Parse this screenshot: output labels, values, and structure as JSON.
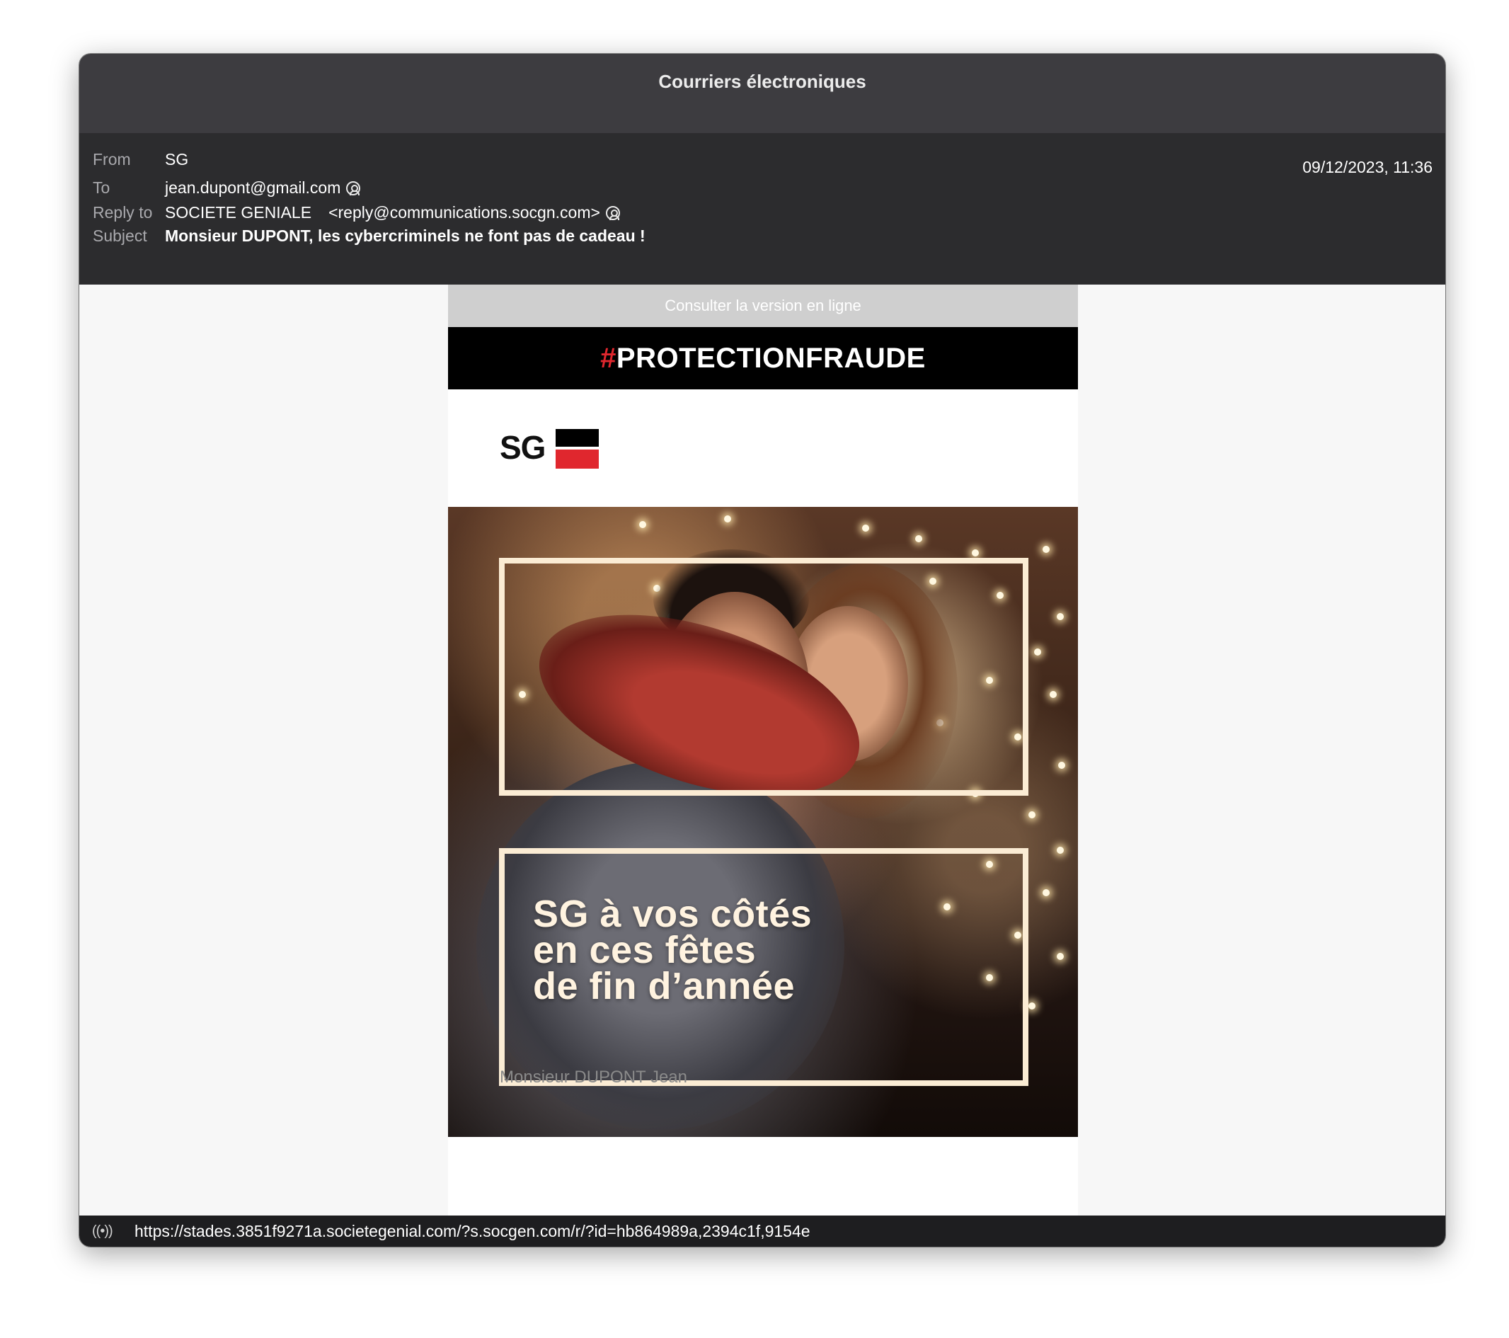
{
  "window": {
    "title": "Courriers électroniques"
  },
  "header": {
    "from_label": "From",
    "from_value": "SG",
    "to_label": "To",
    "to_value": "jean.dupont@gmail.com",
    "reply_label": "Reply to",
    "reply_name": "SOCIETE GENIALE",
    "reply_email": "<reply@communications.socgn.com>",
    "subject_label": "Subject",
    "subject_value": "Monsieur DUPONT, les cybercriminels ne font pas de cadeau !",
    "date": "09/12/2023, 11:36"
  },
  "email": {
    "online_link": "Consulter la version en ligne",
    "banner_hash": "#",
    "banner_text": "PROTECTIONFRAUDE",
    "logo_text": "SG",
    "hero_line1": "SG à vos côtés",
    "hero_line2": "en ces fêtes",
    "hero_line3": "de fin d’année",
    "recipient": "Monsieur DUPONT Jean"
  },
  "status": {
    "url": "https://stades.3851f9271a.societegenial.com/?s.socgen.com/r/?id=hb864989a,2394c1f,9154e"
  },
  "colors": {
    "brand_red": "#e0272e",
    "header_bg": "#2c2c2e",
    "titlebar_bg": "#3d3c40"
  },
  "icons": [
    "person-circle-icon",
    "broadcast-icon"
  ]
}
